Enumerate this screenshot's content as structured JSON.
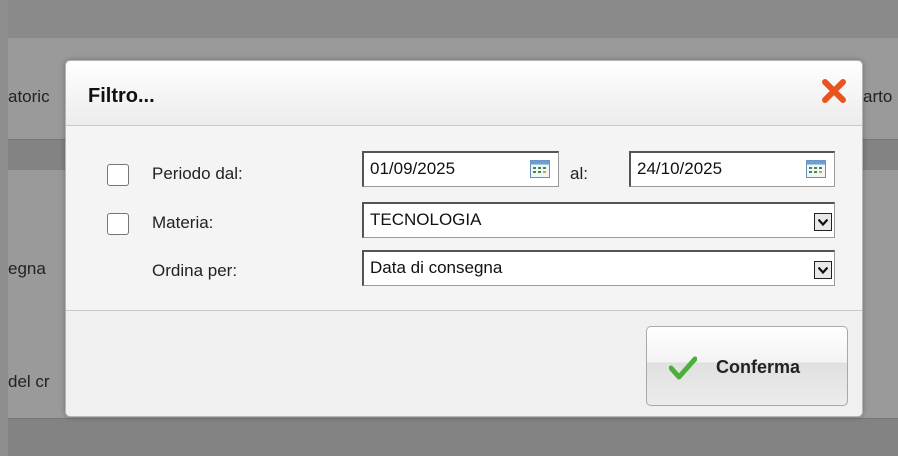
{
  "background": {
    "left_fragments": [
      "atoric",
      "egna",
      "del cr"
    ],
    "right_fragment": "arto"
  },
  "dialog": {
    "title": "Filtro...",
    "close_icon": "close-x-icon",
    "close_color": "#e8541d",
    "period": {
      "label": "Periodo dal:",
      "checked": false,
      "from": "01/09/2025",
      "to_label": "al:",
      "to": "24/10/2025",
      "calendar_icon": "calendar-icon"
    },
    "subject": {
      "label": "Materia:",
      "checked": false,
      "selected": "TECNOLOGIA"
    },
    "sort": {
      "label": "Ordina per:",
      "selected": "Data di consegna"
    },
    "confirm_button": {
      "label": "Conferma",
      "icon": "checkmark-icon",
      "icon_color": "#4caf3a"
    }
  }
}
